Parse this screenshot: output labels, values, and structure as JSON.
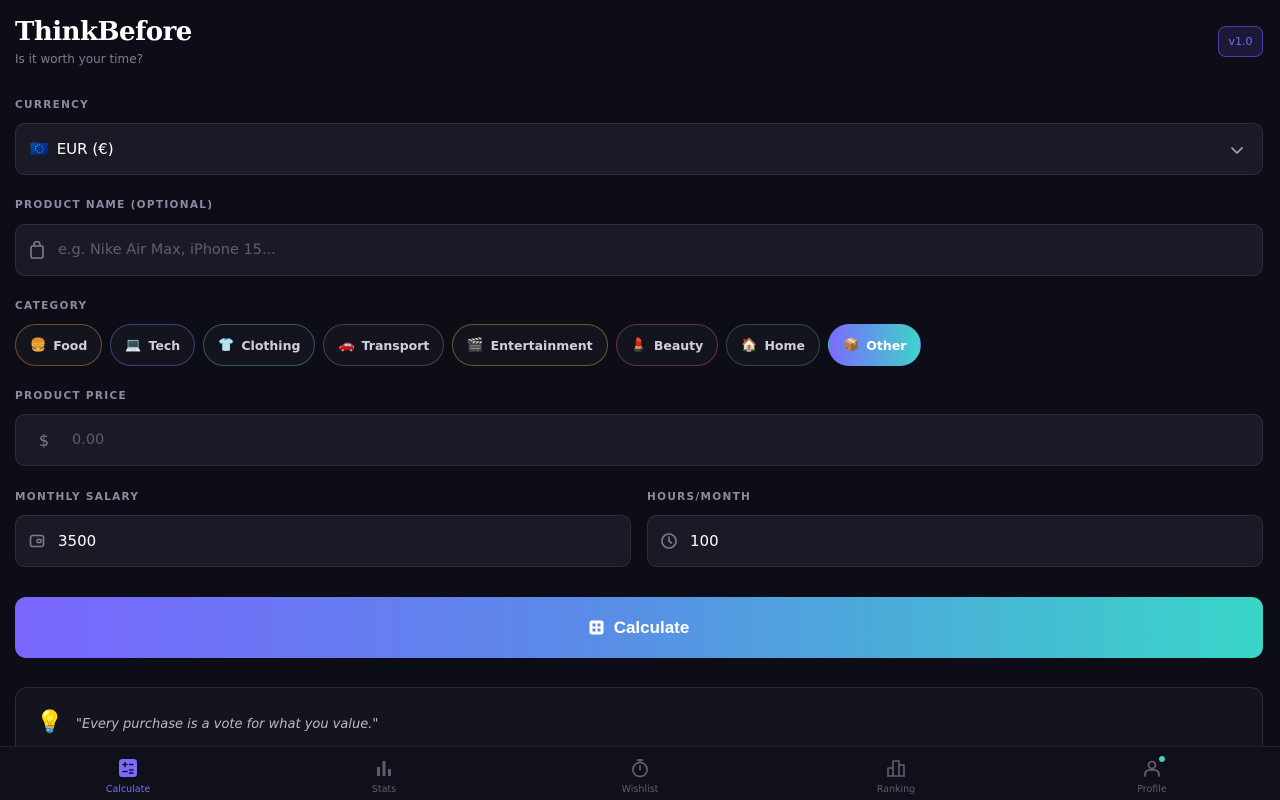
{
  "header": {
    "title": "ThinkBefore",
    "tagline": "Is it worth your time?",
    "version": "v1.0"
  },
  "currency": {
    "label": "CURRENCY",
    "flag": "🇪🇺",
    "selected": "EUR (€)"
  },
  "product_name": {
    "label": "PRODUCT NAME (OPTIONAL)",
    "placeholder": "e.g. Nike Air Max, iPhone 15...",
    "value": ""
  },
  "category": {
    "label": "CATEGORY",
    "items": [
      {
        "emoji": "🍔",
        "label": "Food"
      },
      {
        "emoji": "💻",
        "label": "Tech"
      },
      {
        "emoji": "👕",
        "label": "Clothing"
      },
      {
        "emoji": "🚗",
        "label": "Transport"
      },
      {
        "emoji": "🎬",
        "label": "Entertainment"
      },
      {
        "emoji": "💄",
        "label": "Beauty"
      },
      {
        "emoji": "🏠",
        "label": "Home"
      },
      {
        "emoji": "📦",
        "label": "Other"
      }
    ],
    "selected": "Other"
  },
  "price": {
    "label": "PRODUCT PRICE",
    "symbol": "$",
    "placeholder": "0.00",
    "value": ""
  },
  "salary": {
    "label": "MONTHLY SALARY",
    "value": "3500"
  },
  "hours": {
    "label": "HOURS/MONTH",
    "value": "100"
  },
  "calculate_label": "Calculate",
  "quote": {
    "emoji": "💡",
    "text": "\"Every purchase is a vote for what you value.\""
  },
  "nav": {
    "items": [
      {
        "label": "Calculate",
        "icon": "calculator-icon",
        "active": true
      },
      {
        "label": "Stats",
        "icon": "bar-chart-icon",
        "active": false
      },
      {
        "label": "Wishlist",
        "icon": "stopwatch-icon",
        "active": false
      },
      {
        "label": "Ranking",
        "icon": "podium-icon",
        "active": false
      },
      {
        "label": "Profile",
        "icon": "user-icon",
        "active": false
      }
    ]
  },
  "colors": {
    "background": "#0d0d18",
    "accent_purple": "#7a6cff",
    "accent_teal": "#3ed3c9"
  }
}
